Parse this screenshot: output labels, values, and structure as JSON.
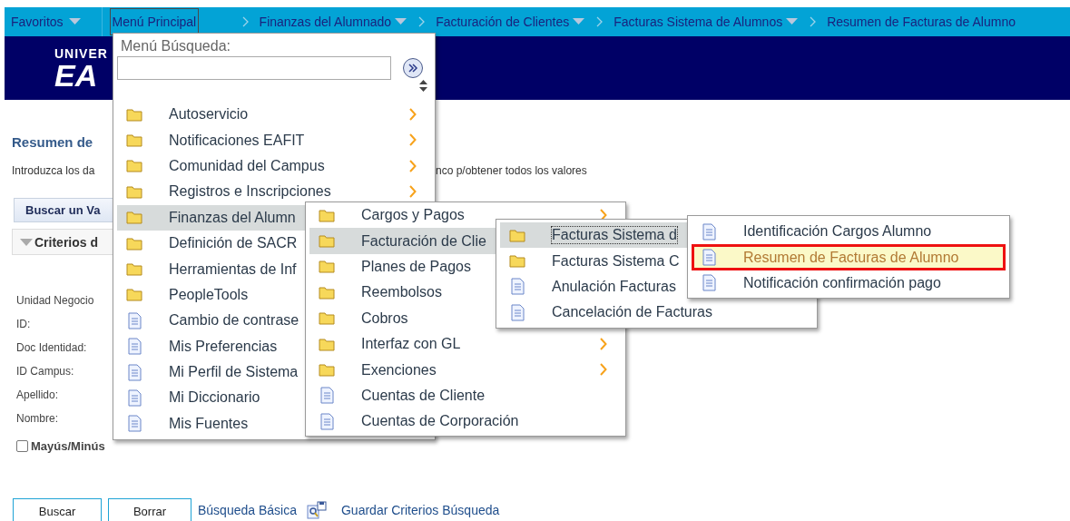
{
  "nav": {
    "favorites": {
      "label": "Favoritos",
      "dropdown": true
    },
    "main_menu": {
      "label": "Menú Principal",
      "selected": true
    },
    "breadcrumbs": [
      {
        "label": "Finanzas del Alumnado",
        "dropdown": true
      },
      {
        "label": "Facturación de Clientes",
        "dropdown": true
      },
      {
        "label": "Facturas Sistema de Alumnos",
        "dropdown": true
      },
      {
        "label": "Resumen de Facturas de Alumno",
        "dropdown": false
      }
    ]
  },
  "banner": {
    "logo_lines": [
      "UNIVER",
      "EA"
    ]
  },
  "page": {
    "title": "Resumen de",
    "instructions": [
      "Introduzca los da",
      "nco p/obtener todos los valores"
    ],
    "search_tab": "Buscar un Va",
    "section": {
      "label": "Criterios d",
      "expanded": true
    },
    "fields": [
      "Unidad Negocio",
      "ID:",
      "Doc Identidad:",
      "ID Campus:",
      "Apellido:",
      "Nombre:"
    ],
    "case_checkbox": {
      "label": "Mayús/Minús",
      "checked": false
    },
    "buttons": [
      "Buscar",
      "Borrar"
    ],
    "basic_search_link": "Búsqueda Básica",
    "save_criteria_link": "Guardar Criterios Búsqueda"
  },
  "menus": [
    {
      "header": "Menú Búsqueda:",
      "items": [
        {
          "label": "Autoservicio",
          "kind": "folder",
          "submenu": true,
          "selected": false
        },
        {
          "label": "Notificaciones EAFIT",
          "kind": "folder",
          "submenu": true,
          "selected": false
        },
        {
          "label": "Comunidad del Campus",
          "kind": "folder",
          "submenu": true,
          "selected": false
        },
        {
          "label": "Registros e Inscripciones",
          "kind": "folder",
          "submenu": true,
          "selected": false
        },
        {
          "label": "Finanzas del Alumn",
          "kind": "folder",
          "submenu": false,
          "selected": true
        },
        {
          "label": "Definición de SACR",
          "kind": "folder",
          "submenu": false,
          "selected": false
        },
        {
          "label": "Herramientas de Inf",
          "kind": "folder",
          "submenu": false,
          "selected": false
        },
        {
          "label": "PeopleTools",
          "kind": "folder",
          "submenu": false,
          "selected": false
        },
        {
          "label": "Cambio de contrase",
          "kind": "page",
          "submenu": false,
          "selected": false
        },
        {
          "label": "Mis Preferencias",
          "kind": "page",
          "submenu": false,
          "selected": false
        },
        {
          "label": "Mi Perfil de Sistema",
          "kind": "page",
          "submenu": false,
          "selected": false
        },
        {
          "label": "Mi Diccionario",
          "kind": "page",
          "submenu": false,
          "selected": false
        },
        {
          "label": "Mis Fuentes",
          "kind": "page",
          "submenu": false,
          "selected": false
        }
      ]
    },
    {
      "items": [
        {
          "label": "Cargos y Pagos",
          "kind": "folder",
          "submenu": true,
          "selected": false
        },
        {
          "label": "Facturación de Clie",
          "kind": "folder",
          "submenu": false,
          "selected": true
        },
        {
          "label": "Planes de Pagos",
          "kind": "folder",
          "submenu": false,
          "selected": false
        },
        {
          "label": "Reembolsos",
          "kind": "folder",
          "submenu": false,
          "selected": false
        },
        {
          "label": "Cobros",
          "kind": "folder",
          "submenu": false,
          "selected": false
        },
        {
          "label": "Interfaz con GL",
          "kind": "folder",
          "submenu": true,
          "selected": false
        },
        {
          "label": "Exenciones",
          "kind": "folder",
          "submenu": true,
          "selected": false
        },
        {
          "label": "Cuentas de Cliente",
          "kind": "page",
          "submenu": false,
          "selected": false
        },
        {
          "label": "Cuentas de Corporación",
          "kind": "page",
          "submenu": false,
          "selected": false
        }
      ]
    },
    {
      "items": [
        {
          "label": "Facturas Sistema d",
          "kind": "folder",
          "submenu": false,
          "selected": true
        },
        {
          "label": "Facturas Sistema C",
          "kind": "folder",
          "submenu": false,
          "selected": false
        },
        {
          "label": "Anulación Facturas",
          "kind": "page",
          "submenu": false,
          "selected": false
        },
        {
          "label": "Cancelación de Facturas",
          "kind": "page",
          "submenu": false,
          "selected": false
        }
      ]
    },
    {
      "items": [
        {
          "label": "Identificación Cargos Alumno",
          "kind": "page",
          "submenu": false,
          "selected": false
        },
        {
          "label": "Resumen de Facturas de Alumno",
          "kind": "page",
          "submenu": false,
          "selected": true
        },
        {
          "label": "Notificación confirmación pago",
          "kind": "page",
          "submenu": false,
          "selected": false
        }
      ]
    }
  ]
}
